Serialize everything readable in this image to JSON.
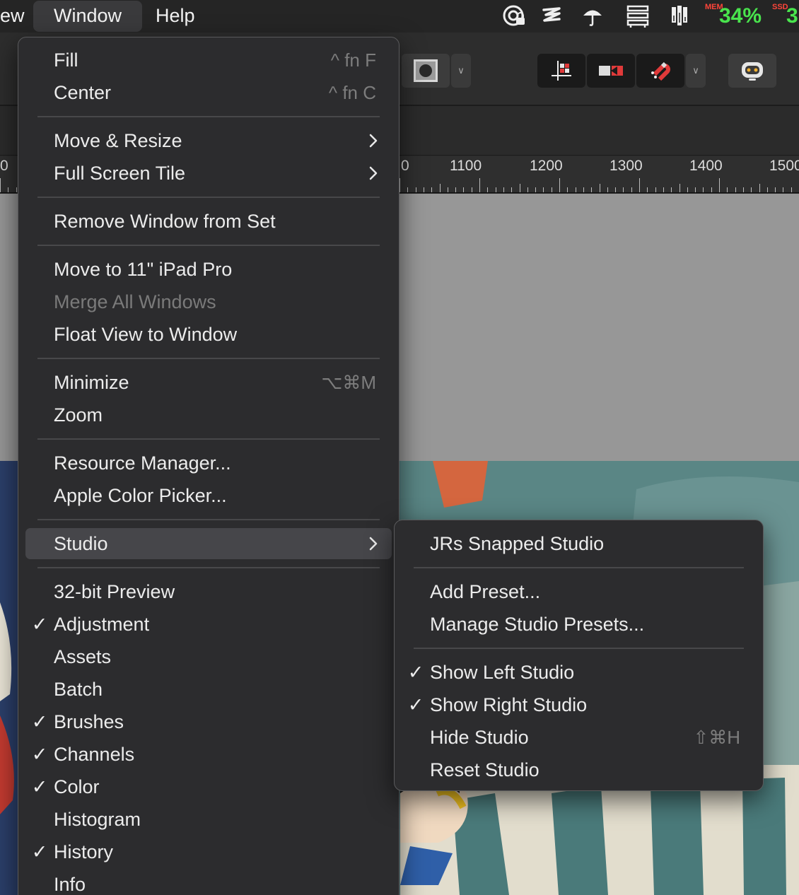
{
  "menubar": {
    "partial_item": "ew",
    "window_label": "Window",
    "help_label": "Help",
    "status": {
      "mem_label": "MEM",
      "mem_percent": "34%",
      "ssd_label": "SSD",
      "ssd_partial": "3"
    }
  },
  "ruler": {
    "partial": "0",
    "labels": [
      "1100",
      "1200",
      "1300",
      "1400",
      "1500"
    ]
  },
  "window_menu": {
    "groups": [
      [
        {
          "label": "Fill",
          "shortcut": "^ fn F"
        },
        {
          "label": "Center",
          "shortcut": "^ fn C"
        }
      ],
      [
        {
          "label": "Move & Resize",
          "submenu": true
        },
        {
          "label": "Full Screen Tile",
          "submenu": true
        }
      ],
      [
        {
          "label": "Remove Window from Set"
        }
      ],
      [
        {
          "label": "Move to 11\" iPad Pro"
        },
        {
          "label": "Merge All Windows",
          "disabled": true
        },
        {
          "label": "Float View to Window"
        }
      ],
      [
        {
          "label": "Minimize",
          "shortcut": "⌥⌘M"
        },
        {
          "label": "Zoom"
        }
      ],
      [
        {
          "label": "Resource Manager..."
        },
        {
          "label": "Apple Color Picker..."
        }
      ],
      [
        {
          "label": "Studio",
          "submenu": true,
          "highlighted": true
        }
      ],
      [
        {
          "label": "32-bit Preview"
        },
        {
          "label": "Adjustment",
          "checked": true
        },
        {
          "label": "Assets"
        },
        {
          "label": "Batch"
        },
        {
          "label": "Brushes",
          "checked": true
        },
        {
          "label": "Channels",
          "checked": true
        },
        {
          "label": "Color",
          "checked": true
        },
        {
          "label": "Histogram"
        },
        {
          "label": "History",
          "checked": true
        },
        {
          "label": "Info"
        }
      ]
    ]
  },
  "studio_submenu": {
    "groups": [
      [
        {
          "label": "JRs Snapped Studio"
        }
      ],
      [
        {
          "label": "Add Preset..."
        },
        {
          "label": "Manage Studio Presets..."
        }
      ],
      [
        {
          "label": "Show Left Studio",
          "checked": true
        },
        {
          "label": "Show Right Studio",
          "checked": true
        },
        {
          "label": "Hide Studio",
          "shortcut": "⇧⌘H"
        },
        {
          "label": "Reset Studio"
        }
      ]
    ]
  },
  "check_glyph": "✓",
  "colors": {
    "menu_bg": "#2c2c2e",
    "highlight": "#46464a",
    "accent_green": "#49e44d",
    "accent_red": "#ff453a",
    "disabled_text": "#7a7a7a"
  }
}
